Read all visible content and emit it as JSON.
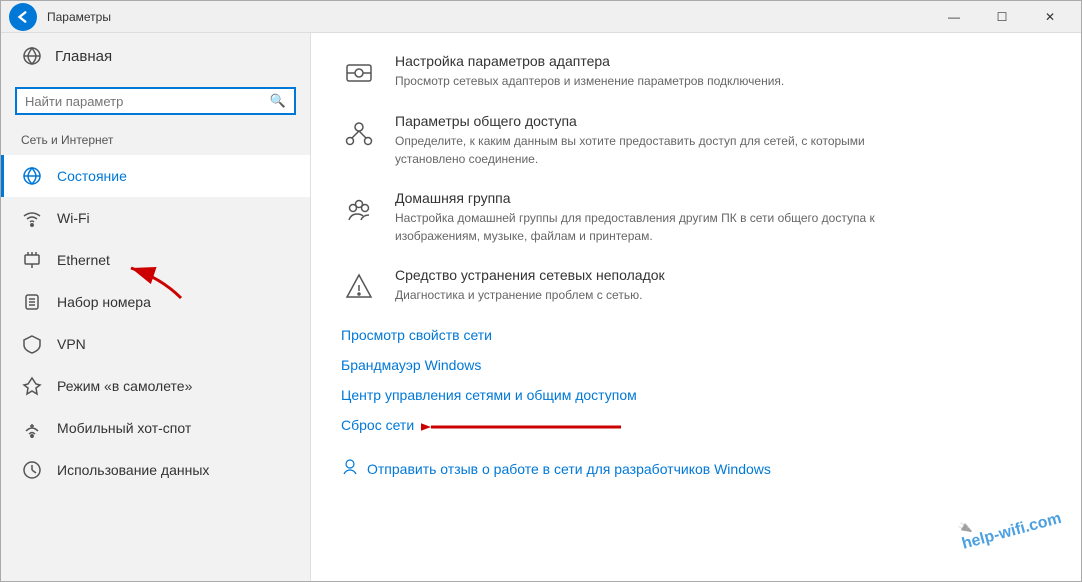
{
  "window": {
    "title": "Параметры",
    "back_label": "←"
  },
  "window_controls": {
    "minimize": "—",
    "maximize": "☐",
    "close": "✕"
  },
  "sidebar": {
    "home_label": "Главная",
    "search_placeholder": "Найти параметр",
    "section_label": "Сеть и Интернет",
    "nav_items": [
      {
        "id": "status",
        "label": "Состояние",
        "icon": "globe",
        "active": true
      },
      {
        "id": "wifi",
        "label": "Wi-Fi",
        "icon": "wifi"
      },
      {
        "id": "ethernet",
        "label": "Ethernet",
        "icon": "ethernet"
      },
      {
        "id": "dialup",
        "label": "Набор номера",
        "icon": "phone"
      },
      {
        "id": "vpn",
        "label": "VPN",
        "icon": "vpn"
      },
      {
        "id": "airplane",
        "label": "Режим «в самолете»",
        "icon": "airplane"
      },
      {
        "id": "hotspot",
        "label": "Мобильный хот-спот",
        "icon": "hotspot"
      },
      {
        "id": "usage",
        "label": "Использование данных",
        "icon": "data"
      }
    ]
  },
  "main": {
    "settings": [
      {
        "id": "adapter",
        "title": "Настройка параметров адаптера",
        "desc": "Просмотр сетевых адаптеров и изменение параметров подключения.",
        "icon": "adapter"
      },
      {
        "id": "sharing",
        "title": "Параметры общего доступа",
        "desc": "Определите, к каким данным вы хотите предоставить доступ для сетей, с которыми установлено соединение.",
        "icon": "sharing"
      },
      {
        "id": "homegroup",
        "title": "Домашняя группа",
        "desc": "Настройка домашней группы для предоставления другим ПК в сети общего доступа к изображениям, музыке, файлам и принтерам.",
        "icon": "homegroup"
      },
      {
        "id": "troubleshoot",
        "title": "Средство устранения сетевых неполадок",
        "desc": "Диагностика и устранение проблем с сетью.",
        "icon": "warning"
      }
    ],
    "links": [
      "Просмотр свойств сети",
      "Брандмауэр Windows",
      "Центр управления сетями и общим доступом",
      "Сброс сети"
    ],
    "footer_link": "Отправить отзыв о работе в сети для разработчиков Windows",
    "watermark": "help-wifi.com"
  }
}
